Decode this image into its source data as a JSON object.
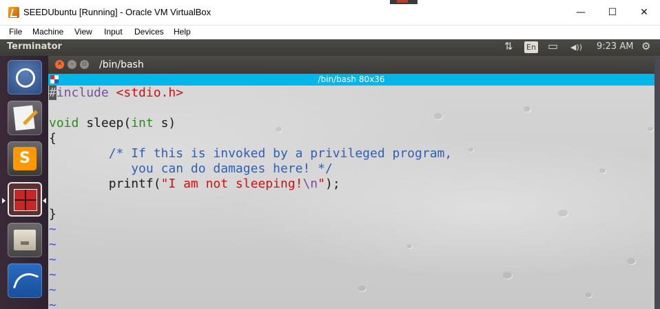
{
  "host_window": {
    "title": "SEEDUbuntu [Running] - Oracle VM VirtualBox",
    "controls": {
      "minimize": "—",
      "maximize": "☐",
      "close": "✕"
    }
  },
  "vbox_menu": [
    "File",
    "Machine",
    "View",
    "Input",
    "Devices",
    "Help"
  ],
  "ubuntu_panel": {
    "app_name": "Terminator",
    "indicators": {
      "network": "⇅",
      "keyboard_lang": "En",
      "battery": "▭",
      "volume": "◀))",
      "time": "9:23 AM",
      "settings": "⚙"
    }
  },
  "launcher": {
    "items": [
      "ubuntu-dash",
      "text-editor",
      "sublime-text",
      "terminator",
      "file-manager",
      "wireshark"
    ],
    "active": "terminator"
  },
  "terminal": {
    "window_title": "/bin/bash",
    "header_title": "/bin/bash 80x36",
    "lines": [
      [
        {
          "t": "#",
          "c": "c-cursor"
        },
        {
          "t": "include ",
          "c": "c-pre"
        },
        {
          "t": "<stdio.h>",
          "c": "c-str"
        }
      ],
      [],
      [
        {
          "t": "void",
          "c": "c-type"
        },
        {
          "t": " sleep(",
          "c": ""
        },
        {
          "t": "int",
          "c": "c-type"
        },
        {
          "t": " s)",
          "c": ""
        }
      ],
      [
        {
          "t": "{",
          "c": ""
        }
      ],
      [
        {
          "t": "        ",
          "c": ""
        },
        {
          "t": "/* If this is invoked by a privileged program,",
          "c": "c-com"
        }
      ],
      [
        {
          "t": "           ",
          "c": ""
        },
        {
          "t": "you can do damages here! */",
          "c": "c-com"
        }
      ],
      [
        {
          "t": "        printf(",
          "c": ""
        },
        {
          "t": "\"I am not sleeping!",
          "c": "c-str"
        },
        {
          "t": "\\n",
          "c": "c-pre"
        },
        {
          "t": "\"",
          "c": "c-str"
        },
        {
          "t": ");",
          "c": ""
        }
      ],
      [],
      [
        {
          "t": "}",
          "c": ""
        }
      ],
      [
        {
          "t": "~",
          "c": "c-tilde"
        }
      ],
      [
        {
          "t": "~",
          "c": "c-tilde"
        }
      ],
      [
        {
          "t": "~",
          "c": "c-tilde"
        }
      ],
      [
        {
          "t": "~",
          "c": "c-tilde"
        }
      ],
      [
        {
          "t": "~",
          "c": "c-tilde"
        }
      ],
      [
        {
          "t": "~",
          "c": "c-tilde"
        }
      ]
    ]
  },
  "colors": {
    "ubuntu_panel": "#3c3b37",
    "terminator_header": "#00b7eb",
    "close_button": "#f26a35"
  }
}
